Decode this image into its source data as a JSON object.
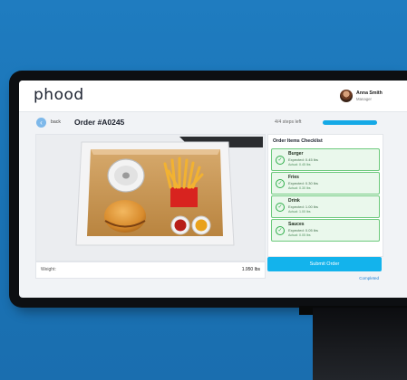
{
  "header": {
    "logo": "phood",
    "user_name": "Anna Smith",
    "user_role": "Manager"
  },
  "order": {
    "back_label": "back",
    "title": "Order #A0245",
    "steps_label": "4/4 steps left",
    "progress": 1.0
  },
  "weight": {
    "label": "Weight:",
    "value": "1.950 lbs"
  },
  "checklist": {
    "title": "Order Items Checklist",
    "items": [
      {
        "name": "Burger",
        "expected": "Expected: 0.45 lbs",
        "actual": "Actual: 0.45 lbs"
      },
      {
        "name": "Fries",
        "expected": "Expected: 0.30 lbs",
        "actual": "Actual: 0.30 lbs"
      },
      {
        "name": "Drink",
        "expected": "Expected: 1.00 lbs",
        "actual": "Actual: 1.00 lbs"
      },
      {
        "name": "Sauces",
        "expected": "Expected: 0.05 lbs",
        "actual": "Actual: 0.05 lbs"
      }
    ]
  },
  "actions": {
    "submit_label": "Submit Order",
    "completed_label": "Completed"
  },
  "colors": {
    "background": "#1f7cc0",
    "accent": "#13b3ec",
    "check_green": "#2fae4a"
  }
}
